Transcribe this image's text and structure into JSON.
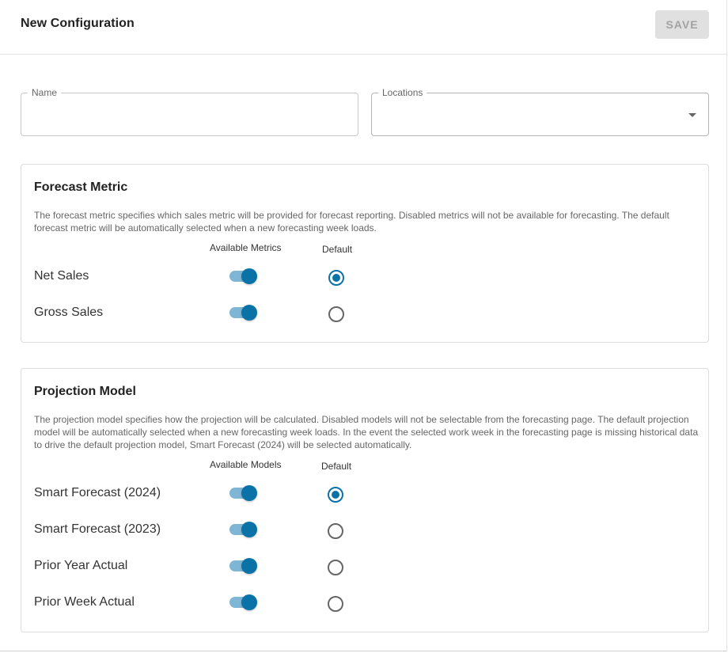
{
  "header": {
    "title": "New Configuration",
    "save_label": "SAVE"
  },
  "fields": {
    "name": {
      "label": "Name",
      "value": ""
    },
    "locations": {
      "label": "Locations",
      "value": ""
    }
  },
  "forecast_metric": {
    "title": "Forecast Metric",
    "description": "The forecast metric specifies which sales metric will be provided for forecast reporting. Disabled metrics will not be available for forecasting. The default forecast metric will be automatically selected when a new forecasting week loads.",
    "col_available": "Available Metrics",
    "col_default": "Default",
    "rows": [
      {
        "label": "Net Sales",
        "enabled": true,
        "default": true
      },
      {
        "label": "Gross Sales",
        "enabled": true,
        "default": false
      }
    ]
  },
  "projection_model": {
    "title": "Projection Model",
    "description": "The projection model specifies how the projection will be calculated. Disabled models will not be selectable from the forecasting page. The default projection model will be automatically selected when a new forecasting week loads. In the event the selected work week in the forecasting page is missing historical data to drive the default projection model, Smart Forecast (2024) will be selected automatically.",
    "col_available": "Available Models",
    "col_default": "Default",
    "rows": [
      {
        "label": "Smart Forecast (2024)",
        "enabled": true,
        "default": true
      },
      {
        "label": "Smart Forecast (2023)",
        "enabled": true,
        "default": false
      },
      {
        "label": "Prior Year Actual",
        "enabled": true,
        "default": false
      },
      {
        "label": "Prior Week Actual",
        "enabled": true,
        "default": false
      }
    ]
  },
  "colors": {
    "accent": "#0b72a8",
    "toggle_track": "#7fb6d6",
    "save_disabled_bg": "#e0e0e0"
  }
}
